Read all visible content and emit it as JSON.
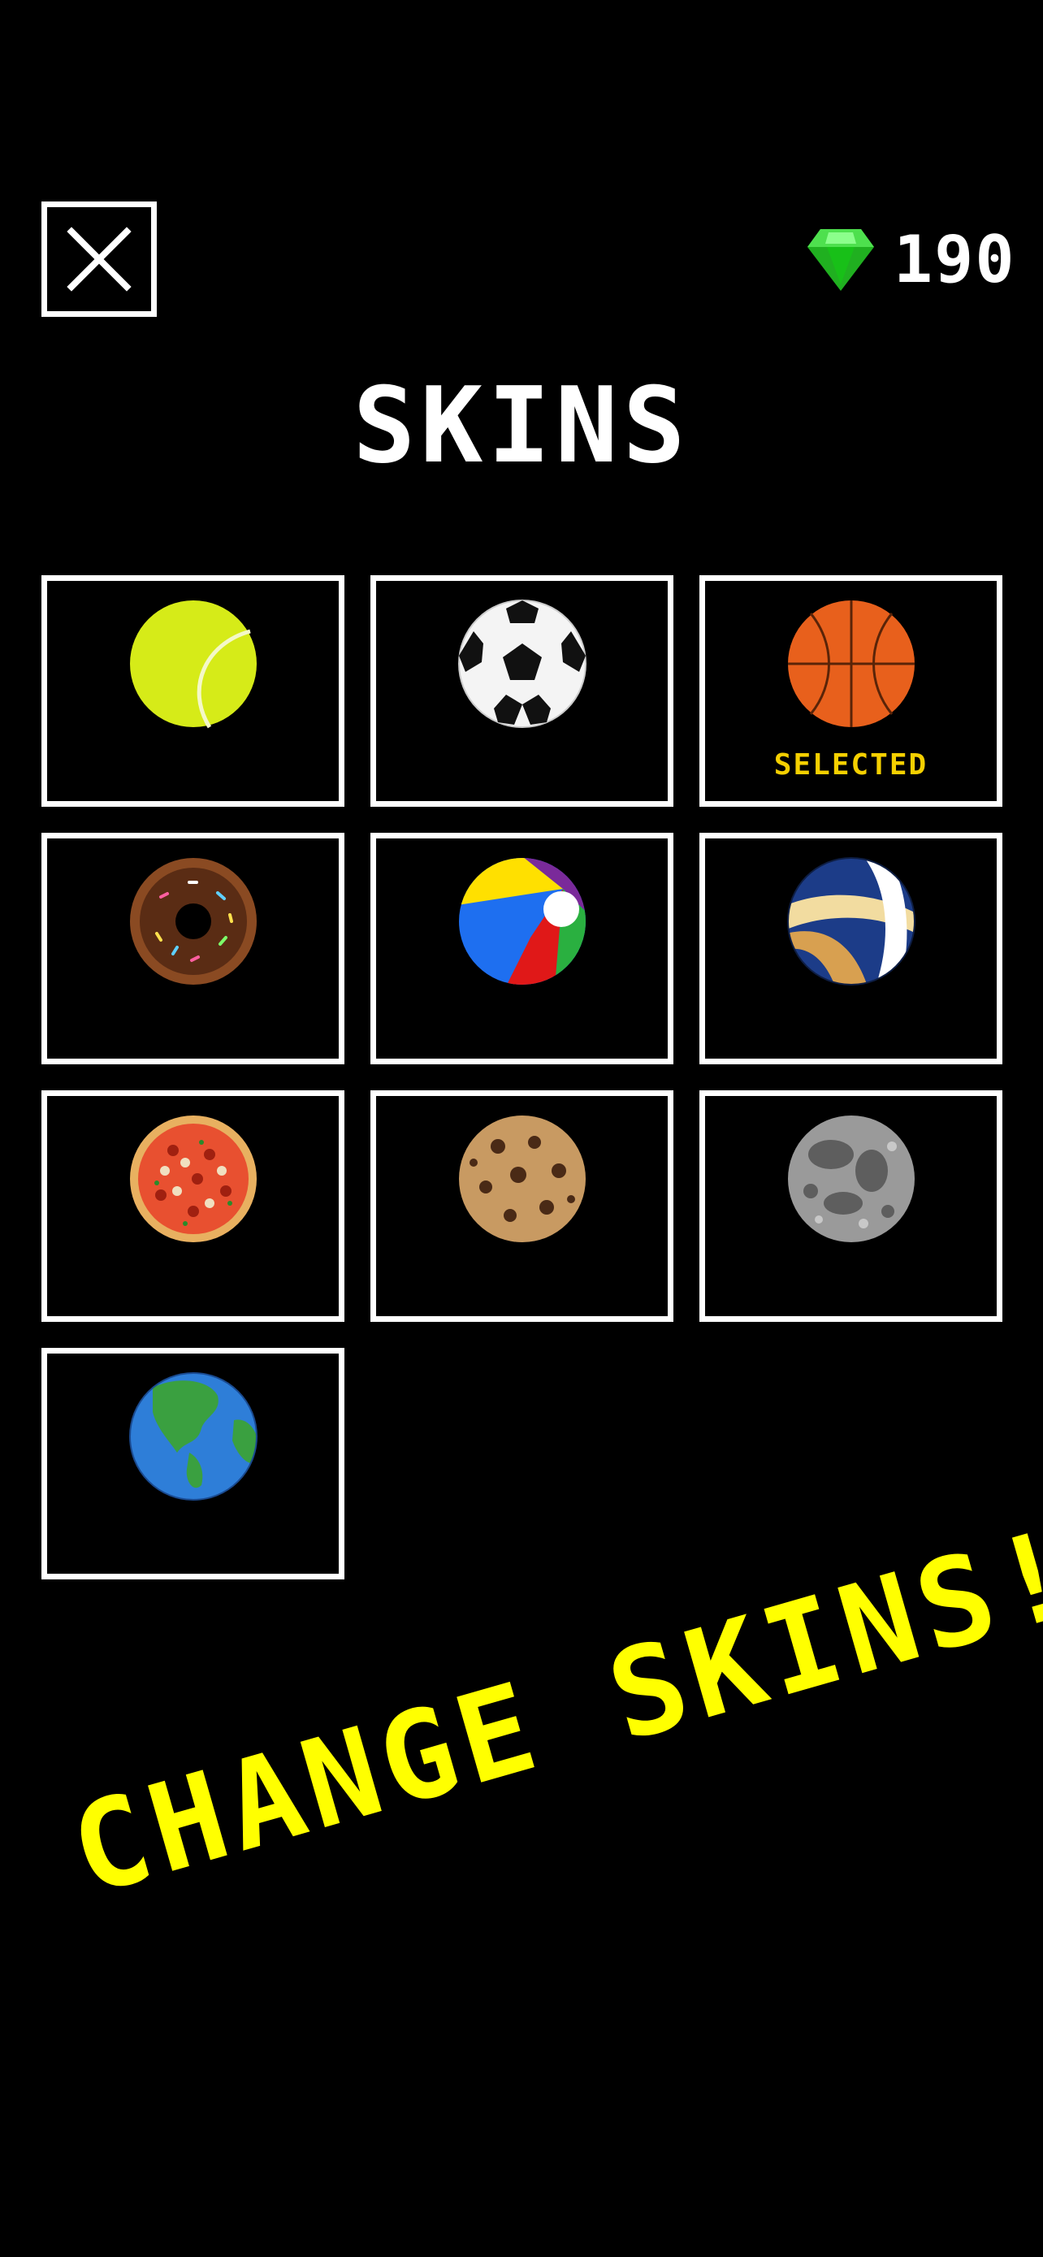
{
  "header": {
    "gem_count": "190"
  },
  "title": "SKINS",
  "skins": [
    {
      "name": "tennis-ball",
      "selected": false
    },
    {
      "name": "soccer-ball",
      "selected": false
    },
    {
      "name": "basketball",
      "selected": true,
      "label": "SELECTED"
    },
    {
      "name": "donut",
      "selected": false
    },
    {
      "name": "beach-ball",
      "selected": false
    },
    {
      "name": "volleyball",
      "selected": false
    },
    {
      "name": "pizza",
      "selected": false
    },
    {
      "name": "cookie",
      "selected": false
    },
    {
      "name": "moon",
      "selected": false
    },
    {
      "name": "earth",
      "selected": false
    }
  ],
  "promo_text": "CHANGE SKINS!",
  "colors": {
    "background": "#000000",
    "accent_yellow": "#ffff00",
    "selected_label": "#f5d000",
    "gem_green": "#22cc22"
  }
}
